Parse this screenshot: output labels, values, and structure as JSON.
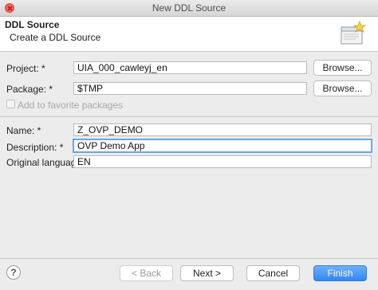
{
  "window": {
    "title": "New DDL Source"
  },
  "banner": {
    "title": "DDL Source",
    "description": "Create a DDL Source",
    "icon": "new-file-wizard-icon"
  },
  "project": {
    "label": "Project: *",
    "value": "UIA_000_cawleyj_en",
    "browse_label": "Browse..."
  },
  "package": {
    "label": "Package: *",
    "value": "$TMP",
    "browse_label": "Browse..."
  },
  "favorite": {
    "label": "Add to favorite packages",
    "checked": false,
    "enabled": false
  },
  "name": {
    "label": "Name: *",
    "value": "Z_OVP_DEMO"
  },
  "description": {
    "label": "Description: *",
    "value": "OVP Demo App"
  },
  "original_language": {
    "label": "Original language:",
    "value": "EN"
  },
  "footer": {
    "help_icon": "help-icon",
    "back_label": "< Back",
    "next_label": "Next >",
    "cancel_label": "Cancel",
    "finish_label": "Finish"
  },
  "colors": {
    "accent": "#2f86f6",
    "focus_ring": "#6aa5e8",
    "close": "#fc5f57"
  }
}
